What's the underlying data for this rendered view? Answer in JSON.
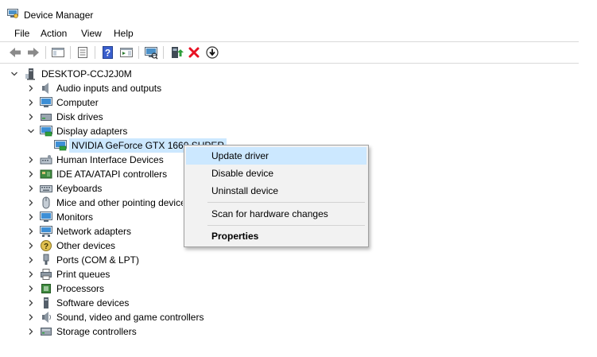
{
  "window": {
    "title": "Device Manager",
    "icon": "device-manager-icon"
  },
  "menu": {
    "file": "File",
    "action": "Action",
    "view": "View",
    "help": "Help"
  },
  "toolbar": {
    "buttons": [
      "back-arrow-icon",
      "forward-arrow-icon",
      "show-hide-console-tree-icon",
      "properties-icon",
      "help-icon",
      "action-pane-icon",
      "scan-hardware-icon",
      "update-driver-icon",
      "uninstall-device-icon",
      "download-driver-icon"
    ]
  },
  "tree": {
    "root": "DESKTOP-CCJ2J0M",
    "categories": [
      {
        "label": "Audio inputs and outputs",
        "icon": "speaker-icon"
      },
      {
        "label": "Computer",
        "icon": "computer-icon"
      },
      {
        "label": "Disk drives",
        "icon": "disk-drive-icon"
      },
      {
        "label": "Display adapters",
        "icon": "display-adapter-icon",
        "expanded": true
      },
      {
        "label": "Human Interface Devices",
        "icon": "hid-icon"
      },
      {
        "label": "IDE ATA/ATAPI controllers",
        "icon": "ide-controller-icon"
      },
      {
        "label": "Keyboards",
        "icon": "keyboard-icon"
      },
      {
        "label": "Mice and other pointing devices",
        "icon": "mouse-icon"
      },
      {
        "label": "Monitors",
        "icon": "monitor-icon"
      },
      {
        "label": "Network adapters",
        "icon": "network-adapter-icon"
      },
      {
        "label": "Other devices",
        "icon": "other-devices-icon"
      },
      {
        "label": "Ports (COM & LPT)",
        "icon": "port-icon"
      },
      {
        "label": "Print queues",
        "icon": "printer-icon"
      },
      {
        "label": "Processors",
        "icon": "processor-icon"
      },
      {
        "label": "Software devices",
        "icon": "software-device-icon"
      },
      {
        "label": "Sound, video and game controllers",
        "icon": "sound-controller-icon"
      },
      {
        "label": "Storage controllers",
        "icon": "storage-controller-icon"
      }
    ],
    "display_child": "NVIDIA GeForce GTX 1660 SUPER"
  },
  "context_menu": {
    "update_driver": "Update driver",
    "disable_device": "Disable device",
    "uninstall_device": "Uninstall device",
    "scan_hardware": "Scan for hardware changes",
    "properties": "Properties"
  },
  "colors": {
    "selection": "#cce8ff",
    "menu_bg": "#f2f2f2",
    "accent": "#0078d7",
    "uninstall_red": "#e81123"
  }
}
